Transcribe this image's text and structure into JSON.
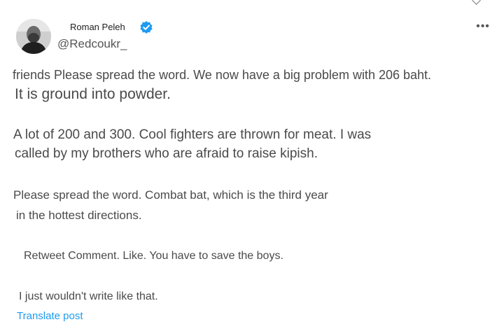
{
  "post": {
    "author": {
      "display_name": "Roman Peleh",
      "handle": "@Redcoukr_",
      "avatar_icon": "person-avatar",
      "verified_icon": "verified-badge-icon",
      "verified_color": "#1d9bf0"
    },
    "more_menu": {
      "icon": "more-horizontal-icon",
      "label": "•••"
    },
    "body_lines": [
      "friends Please spread the word. We now have a big problem with 206 baht.",
      "It is ground into powder.",
      "A lot of 200 and 300. Cool fighters are thrown for meat. I was",
      "called by my brothers who are afraid to raise kipish.",
      "Please spread the word. Combat bat, which is the third year",
      "in the hottest directions.",
      "Retweet Comment. Like. You have to save the boys.",
      "I just wouldn't write like that."
    ],
    "translate_label": "Translate post",
    "translate_color": "#1d9bf0"
  }
}
